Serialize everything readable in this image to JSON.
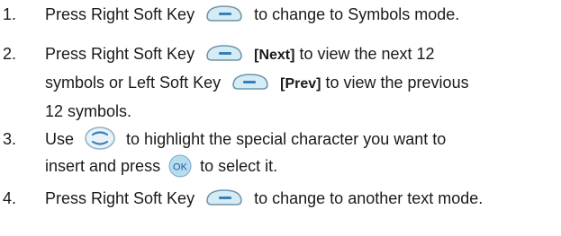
{
  "steps": [
    {
      "number": "1.",
      "lines": [
        {
          "before": "Press Right Soft Key",
          "icon": "right-soft-key-icon",
          "after": "to change to Symbols mode."
        }
      ]
    },
    {
      "number": "2.",
      "line1_before": "Press Right Soft Key",
      "line1_icon": "right-soft-key-icon",
      "line1_bold": "[Next]",
      "line1_after": "to view the next 12",
      "line2_before": "symbols or Left Soft Key",
      "line2_icon": "left-soft-key-icon",
      "line2_bold": "[Prev]",
      "line2_after": "to view the previous",
      "line3": "12 symbols."
    },
    {
      "number": "3.",
      "line1_before": "Use",
      "line1_icon": "navigation-key-icon",
      "line1_after": "to highlight the special character you want to",
      "line2_before": "insert and press",
      "line2_icon": "ok-key-icon",
      "ok_label": "OK",
      "line2_after": "to select it."
    },
    {
      "number": "4.",
      "before": "Press Right Soft Key",
      "icon": "right-soft-key-icon",
      "after": "to change to another text mode."
    }
  ],
  "colors": {
    "softkey_fill": "#d4ecf6",
    "softkey_stroke": "#6f93a6",
    "softkey_bar": "#3a80b8",
    "ok_fill": "#b7dcf0",
    "ok_text": "#1a5e9a"
  }
}
